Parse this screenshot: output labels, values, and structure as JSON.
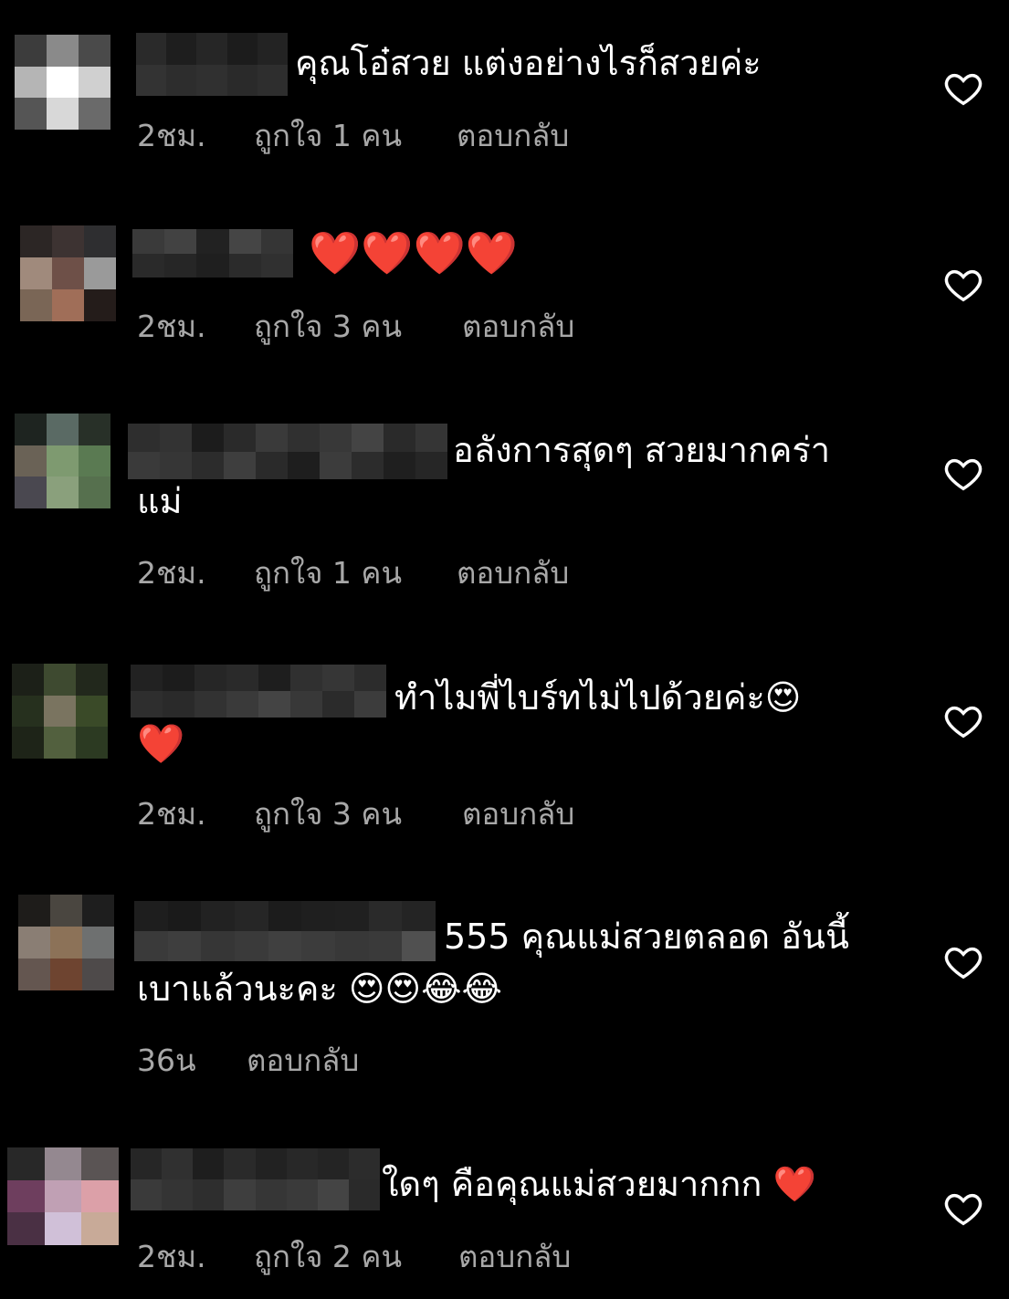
{
  "comments": [
    {
      "text": "คุณโอ๋สวย แต่งอย่างไรก็สวยค่ะ",
      "text2": "",
      "time": "2ชม.",
      "likes": "ถูกใจ 1 คน",
      "reply": "ตอบกลับ"
    },
    {
      "text": "❤️❤️❤️❤️",
      "text2": "",
      "time": "2ชม.",
      "likes": "ถูกใจ 3 คน",
      "reply": "ตอบกลับ"
    },
    {
      "text": "อลังการสุดๆ สวยมากคร่า",
      "text2": "แม่",
      "time": "2ชม.",
      "likes": "ถูกใจ 1 คน",
      "reply": "ตอบกลับ"
    },
    {
      "text": "ทำไมพี่ไบร์ทไม่ไปด้วยค่ะ😍",
      "text2": "❤️",
      "time": "2ชม.",
      "likes": "ถูกใจ 3 คน",
      "reply": "ตอบกลับ"
    },
    {
      "text": "555 คุณแม่สวยตลอด อันนี้",
      "text2": "เบาแล้วนะคะ 😍😍😂😂",
      "time": "36น",
      "likes": "",
      "reply": "ตอบกลับ"
    },
    {
      "text": "ใดๆ คือคุณแม่สวยมากกก ❤️",
      "text2": "",
      "time": "2ชม.",
      "likes": "ถูกใจ 2 คน",
      "reply": "ตอบกลับ"
    }
  ],
  "icons": {
    "like": "heart-outline-icon"
  }
}
